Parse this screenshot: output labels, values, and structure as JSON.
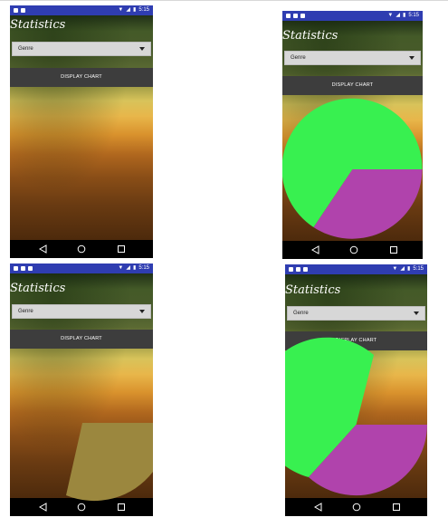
{
  "app": {
    "title": "Statistics",
    "dropdown_value": "Genre",
    "button_label": "DISPLAY CHART",
    "status_time": "5:15"
  },
  "icons": [
    "download-icon",
    "sd-card-icon",
    "wifi-icon",
    "signal-icon",
    "battery-icon",
    "back-icon",
    "home-icon",
    "recent-apps-icon",
    "chevron-down-icon"
  ],
  "colors": {
    "status_bar": "#2f3db1",
    "button": "#3d3d3d",
    "green": "#38f050",
    "magenta": "#b043ac",
    "olive": "#9b873e"
  },
  "chart_data": [
    {
      "type": "pie",
      "screen": "top-left",
      "series": []
    },
    {
      "type": "pie",
      "screen": "top-right",
      "values": [
        {
          "color": "#38f050",
          "share": 0.66
        },
        {
          "color": "#b043ac",
          "share": 0.34
        }
      ]
    },
    {
      "type": "pie",
      "screen": "bottom-left",
      "values": [
        {
          "color": "#9b873e",
          "share": 1.0
        }
      ],
      "note_visible_portion": "partial wedge"
    },
    {
      "type": "pie",
      "screen": "bottom-right",
      "values": [
        {
          "color": "#38f050",
          "share": 0.7
        },
        {
          "color": "#b043ac",
          "share": 0.3
        }
      ]
    }
  ]
}
